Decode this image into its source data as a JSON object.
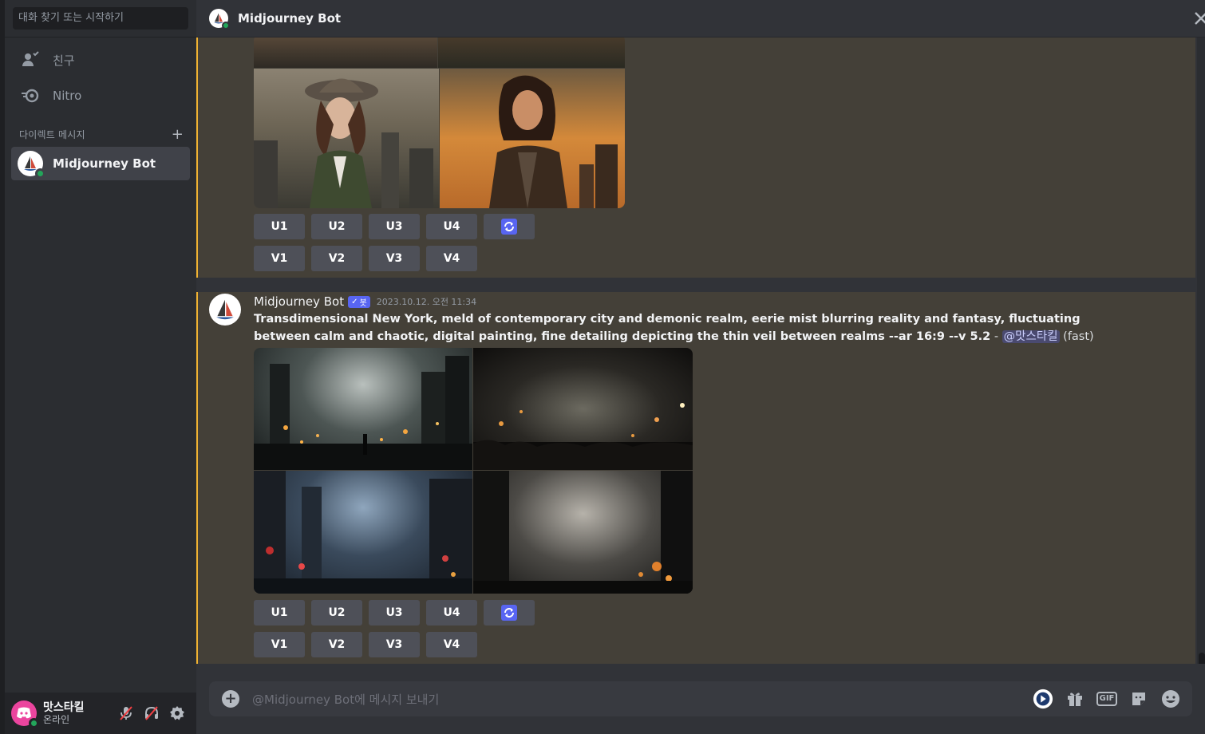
{
  "sidebar": {
    "search_placeholder": "대화 찾기 또는 시작하기",
    "nav": [
      {
        "label": "친구",
        "icon": "friends-icon"
      },
      {
        "label": "Nitro",
        "icon": "nitro-icon"
      }
    ],
    "dm_header": "다이렉트 메시지",
    "dm_add": "+",
    "dms": [
      {
        "name": "Midjourney Bot",
        "status": "online",
        "selected": true
      }
    ]
  },
  "user": {
    "name": "맛스타킬",
    "status": "온라인"
  },
  "header": {
    "title": "Midjourney Bot"
  },
  "messages": [
    {
      "buttons_upscale": [
        "U1",
        "U2",
        "U3",
        "U4"
      ],
      "buttons_variation": [
        "V1",
        "V2",
        "V3",
        "V4"
      ]
    },
    {
      "author": "Midjourney Bot",
      "bot_tag": "봇",
      "timestamp": "2023.10.12. 오전 11:34",
      "prompt": "Transdimensional New York, meld of contemporary city and demonic realm, eerie mist blurring reality and fantasy, fluctuating between calm and chaotic, digital painting, fine detailing depicting the thin veil between realms --ar 16:9 --v 5.2",
      "separator": " - ",
      "mention": "@맛스타킬",
      "speed": "(fast)",
      "buttons_upscale": [
        "U1",
        "U2",
        "U3",
        "U4"
      ],
      "buttons_variation": [
        "V1",
        "V2",
        "V3",
        "V4"
      ]
    }
  ],
  "composer": {
    "placeholder": "@Midjourney Bot에 메시지 보내기",
    "gif_label": "GIF"
  },
  "colors": {
    "accent": "#5865f2",
    "highlight_bar": "#f0b232",
    "online": "#23a55a"
  }
}
